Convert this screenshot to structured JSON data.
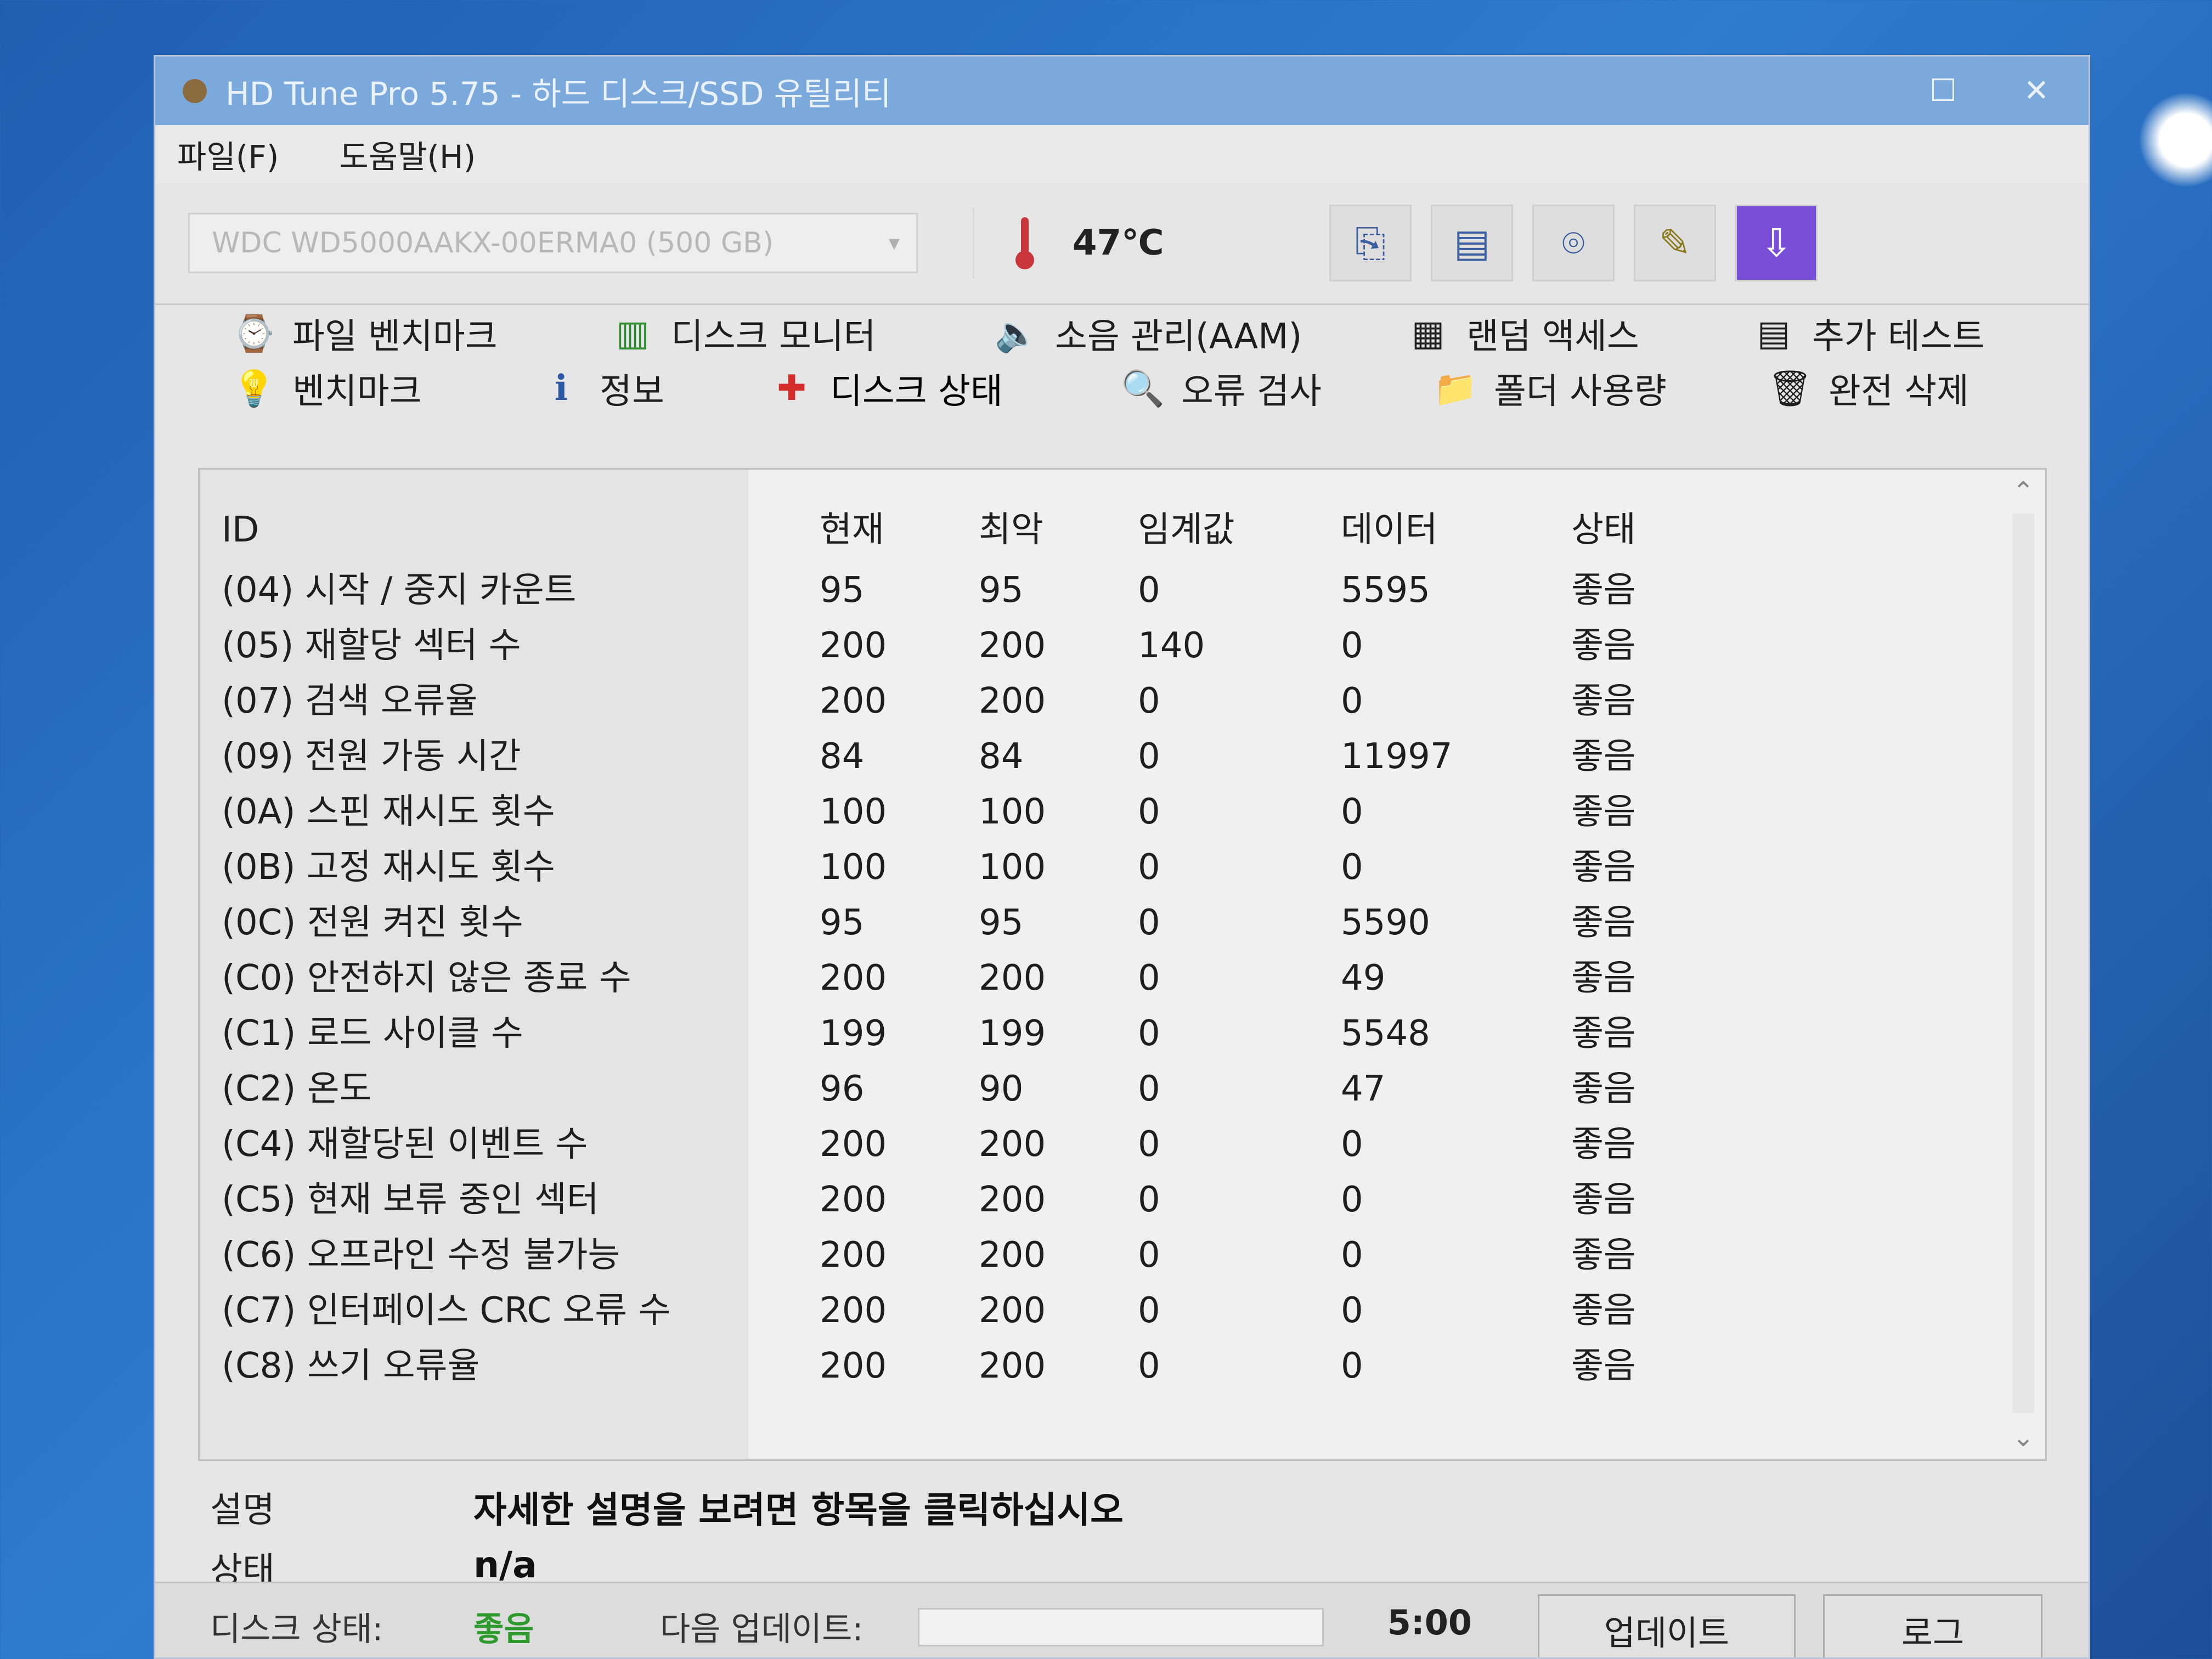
{
  "window": {
    "title": "HD Tune Pro 5.75 - 하드 디스크/SSD 유틸리티",
    "controls": {
      "maximize": "☐",
      "close": "✕"
    }
  },
  "menu": [
    "파일(F)",
    "도움말(H)"
  ],
  "toolbar": {
    "drive": "WDC WD5000AAKX-00ERMA0 (500 GB)",
    "temperature": "47℃",
    "buttons": [
      {
        "icon": "copy-text-icon",
        "glyph": "⎘"
      },
      {
        "icon": "copy-info-icon",
        "glyph": "▤"
      },
      {
        "icon": "camera-icon",
        "glyph": "⌾"
      },
      {
        "icon": "settings-icon",
        "glyph": "✎"
      },
      {
        "icon": "exit-icon",
        "glyph": "⇩"
      }
    ]
  },
  "tabs_row1": [
    {
      "label": "파일 벤치마크",
      "icon": "file-benchmark-icon",
      "glyph": "⌚"
    },
    {
      "label": "디스크 모니터",
      "icon": "disk-monitor-icon",
      "glyph": "▥"
    },
    {
      "label": "소음 관리(AAM)",
      "icon": "speaker-icon",
      "glyph": "🔈"
    },
    {
      "label": "랜덤 액세스",
      "icon": "random-access-icon",
      "glyph": "▦"
    },
    {
      "label": "추가 테스트",
      "icon": "extra-tests-icon",
      "glyph": "▤"
    }
  ],
  "tabs_row2": [
    {
      "label": "벤치마크",
      "icon": "benchmark-icon",
      "glyph": "💡"
    },
    {
      "label": "정보",
      "icon": "info-icon",
      "glyph": "ℹ"
    },
    {
      "label": "디스크 상태",
      "icon": "health-cross-icon",
      "glyph": "✚"
    },
    {
      "label": "오류 검사",
      "icon": "magnifier-icon",
      "glyph": "🔍"
    },
    {
      "label": "폴더 사용량",
      "icon": "folder-icon",
      "glyph": "📁"
    },
    {
      "label": "완전 삭제",
      "icon": "trash-icon",
      "glyph": "🗑"
    }
  ],
  "table": {
    "headers": {
      "id": "ID",
      "current": "현재",
      "worst": "최악",
      "threshold": "임계값",
      "data": "데이터",
      "status": "상태"
    },
    "rows": [
      {
        "id": "(04) 시작 / 중지 카운트",
        "current": "95",
        "worst": "95",
        "threshold": "0",
        "data": "5595",
        "status": "좋음"
      },
      {
        "id": "(05) 재할당 섹터 수",
        "current": "200",
        "worst": "200",
        "threshold": "140",
        "data": "0",
        "status": "좋음"
      },
      {
        "id": "(07) 검색 오류율",
        "current": "200",
        "worst": "200",
        "threshold": "0",
        "data": "0",
        "status": "좋음"
      },
      {
        "id": "(09) 전원 가동 시간",
        "current": "84",
        "worst": "84",
        "threshold": "0",
        "data": "11997",
        "status": "좋음"
      },
      {
        "id": "(0A) 스핀 재시도 횟수",
        "current": "100",
        "worst": "100",
        "threshold": "0",
        "data": "0",
        "status": "좋음"
      },
      {
        "id": "(0B) 고정 재시도 횟수",
        "current": "100",
        "worst": "100",
        "threshold": "0",
        "data": "0",
        "status": "좋음"
      },
      {
        "id": "(0C) 전원 켜진 횟수",
        "current": "95",
        "worst": "95",
        "threshold": "0",
        "data": "5590",
        "status": "좋음"
      },
      {
        "id": "(C0) 안전하지 않은 종료 수",
        "current": "200",
        "worst": "200",
        "threshold": "0",
        "data": "49",
        "status": "좋음"
      },
      {
        "id": "(C1) 로드 사이클 수",
        "current": "199",
        "worst": "199",
        "threshold": "0",
        "data": "5548",
        "status": "좋음"
      },
      {
        "id": "(C2) 온도",
        "current": "96",
        "worst": "90",
        "threshold": "0",
        "data": "47",
        "status": "좋음"
      },
      {
        "id": "(C4) 재할당된 이벤트 수",
        "current": "200",
        "worst": "200",
        "threshold": "0",
        "data": "0",
        "status": "좋음"
      },
      {
        "id": "(C5) 현재 보류 중인 섹터",
        "current": "200",
        "worst": "200",
        "threshold": "0",
        "data": "0",
        "status": "좋음"
      },
      {
        "id": "(C6) 오프라인 수정 불가능",
        "current": "200",
        "worst": "200",
        "threshold": "0",
        "data": "0",
        "status": "좋음"
      },
      {
        "id": "(C7) 인터페이스 CRC 오류 수",
        "current": "200",
        "worst": "200",
        "threshold": "0",
        "data": "0",
        "status": "좋음"
      },
      {
        "id": "(C8) 쓰기 오류율",
        "current": "200",
        "worst": "200",
        "threshold": "0",
        "data": "0",
        "status": "좋음"
      }
    ],
    "scroll_up": "⌃",
    "scroll_down": "⌄"
  },
  "details": {
    "description_label": "설명",
    "description_value": "자세한 설명을 보려면 항목을 클릭하십시오",
    "status_label": "상태",
    "status_value": "n/a"
  },
  "statusbar": {
    "disk_status_label": "디스크 상태:",
    "disk_status_value": "좋음",
    "next_update_label": "다음 업데이트:",
    "next_update_time": "5:00",
    "update_button": "업데이트",
    "log_button": "로그"
  },
  "colors": {
    "good": "#2e9a2e",
    "titlebar": "#7ba9dc",
    "health_cross": "#d42b2b",
    "exit_button": "#7a4fd8"
  }
}
